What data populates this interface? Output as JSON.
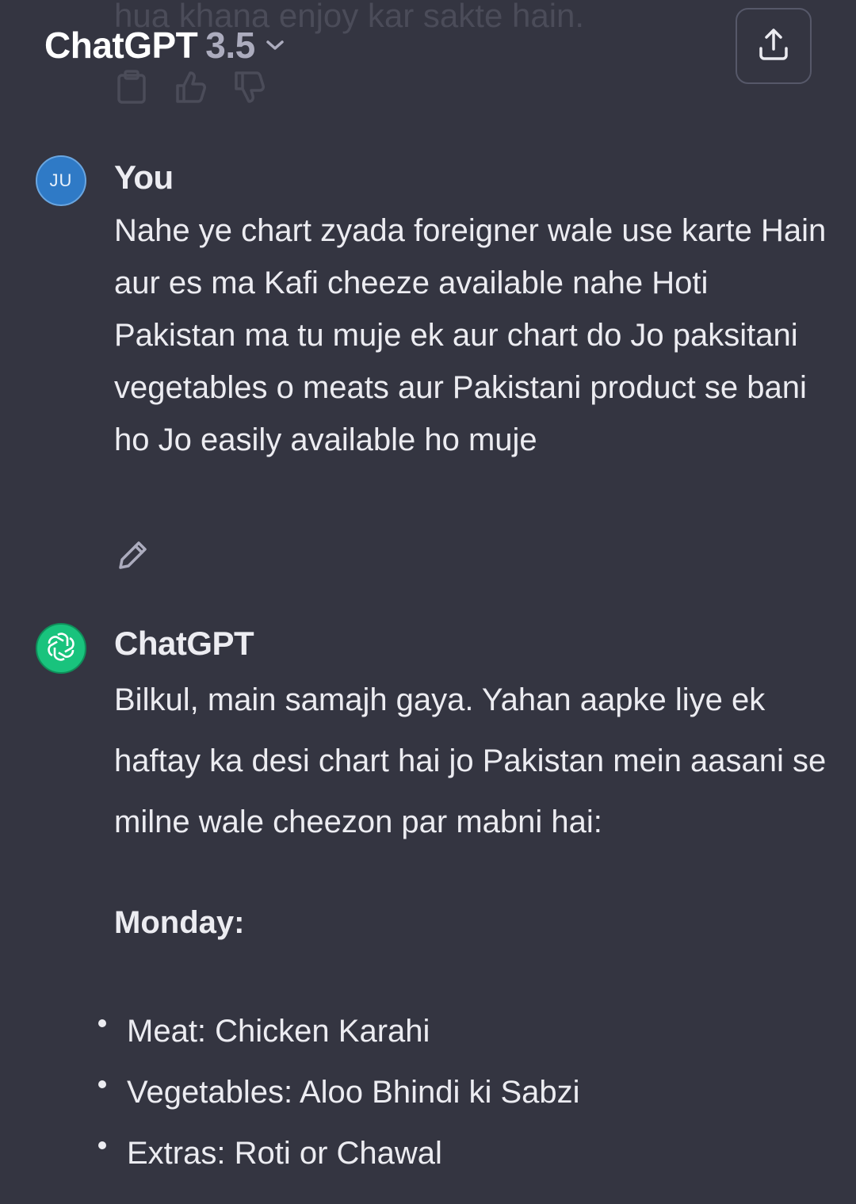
{
  "header": {
    "title": "ChatGPT",
    "version": "3.5",
    "model_dropdown_icon": "chevron-down-icon",
    "share_icon": "share-upload-icon"
  },
  "previous_message": {
    "trailing_text": "hua khana enjoy kar sakte hain.",
    "actions": [
      "clipboard-icon",
      "thumbs-up-icon",
      "thumbs-down-icon"
    ]
  },
  "user_message": {
    "avatar_initials": "JU",
    "sender": "You",
    "text": "Nahe ye chart zyada foreigner wale use karte Hain aur es ma Kafi cheeze available nahe Hoti Pakistan ma tu muje ek aur chart do Jo paksitani vegetables o meats aur Pakistani product se bani ho Jo easily available ho muje",
    "edit_icon": "pencil-icon"
  },
  "assistant_message": {
    "sender": "ChatGPT",
    "avatar_icon": "openai-logo-icon",
    "intro": "Bilkul, main samajh gaya. Yahan aapke liye ek haftay ka desi chart hai jo Pakistan mein aasani se milne wale cheezon par mabni hai:",
    "day": "Monday:",
    "items": [
      "Meat: Chicken Karahi",
      "Vegetables: Aloo Bhindi ki Sabzi",
      "Extras: Roti or Chawal"
    ]
  },
  "colors": {
    "background": "#343541",
    "text": "#ececf1",
    "user_avatar": "#2f7ac6",
    "assistant_avatar": "#19c37d",
    "muted": "#acacbe"
  }
}
